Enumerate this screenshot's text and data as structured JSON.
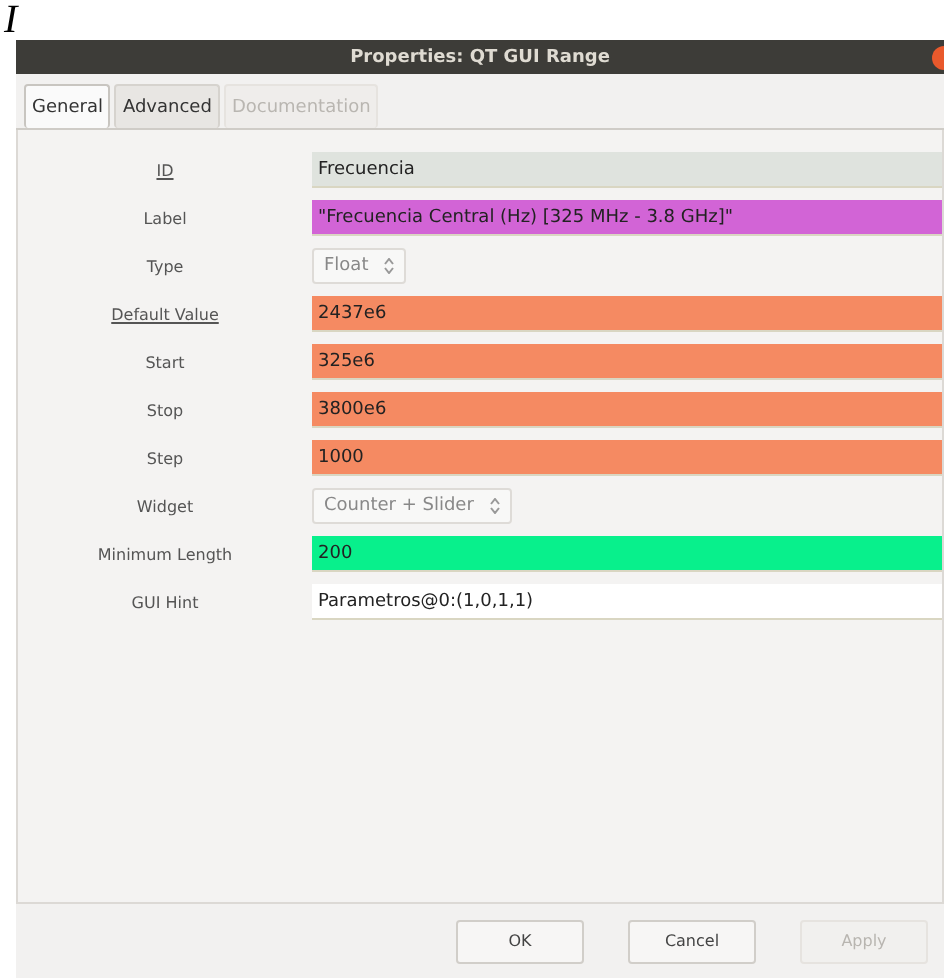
{
  "page_fragment": "I",
  "window": {
    "title": "Properties: QT GUI Range"
  },
  "tabs": [
    {
      "label": "General",
      "selected": true,
      "disabled": false
    },
    {
      "label": "Advanced",
      "selected": false,
      "disabled": false
    },
    {
      "label": "Documentation",
      "selected": false,
      "disabled": true
    }
  ],
  "fields": [
    {
      "label": "ID",
      "underlined": true,
      "kind": "text",
      "value": "Frecuencia",
      "color": "#dfe3de"
    },
    {
      "label": "Label",
      "underlined": false,
      "kind": "text",
      "value": "\"Frecuencia Central (Hz) [325 MHz - 3.8 GHz]\"",
      "color": "#d264d6"
    },
    {
      "label": "Type",
      "underlined": false,
      "kind": "combo",
      "value": "Float"
    },
    {
      "label": "Default Value",
      "underlined": true,
      "kind": "text",
      "value": "2437e6",
      "color": "#f58a62"
    },
    {
      "label": "Start",
      "underlined": false,
      "kind": "text",
      "value": "325e6",
      "color": "#f58a62"
    },
    {
      "label": "Stop",
      "underlined": false,
      "kind": "text",
      "value": "3800e6",
      "color": "#f58a62"
    },
    {
      "label": "Step",
      "underlined": false,
      "kind": "text",
      "value": "1000",
      "color": "#f58a62"
    },
    {
      "label": "Widget",
      "underlined": false,
      "kind": "combo",
      "value": "Counter + Slider"
    },
    {
      "label": "Minimum Length",
      "underlined": false,
      "kind": "text",
      "value": "200",
      "color": "#08f08c"
    },
    {
      "label": "GUI Hint",
      "underlined": false,
      "kind": "text",
      "value": "Parametros@0:(1,0,1,1)",
      "color": "#ffffff"
    }
  ],
  "buttons": [
    {
      "label": "OK",
      "disabled": false
    },
    {
      "label": "Cancel",
      "disabled": false
    },
    {
      "label": "Apply",
      "disabled": true
    }
  ]
}
